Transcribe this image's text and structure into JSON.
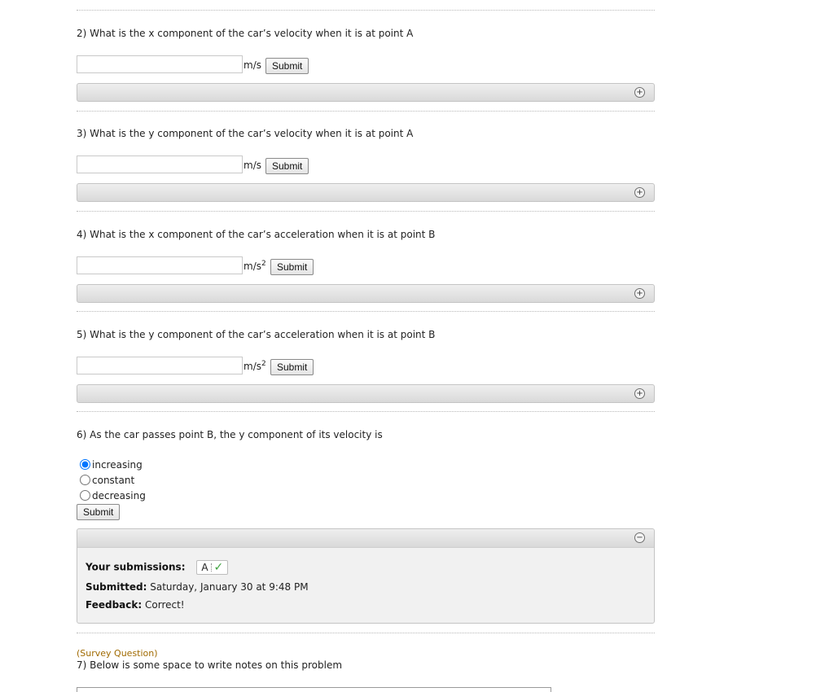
{
  "questions": [
    {
      "label": "2) What is the x component of the car’s velocity when it is at point A",
      "input_value": "",
      "unit": "m/s",
      "unit_exp": "",
      "submit_label": "Submit",
      "toggle": "+"
    },
    {
      "label": "3) What is the y component of the car’s velocity when it is at point A",
      "input_value": "",
      "unit": "m/s",
      "unit_exp": "",
      "submit_label": "Submit",
      "toggle": "+"
    },
    {
      "label": "4) What is the x component of the car’s acceleration when it is at point B",
      "input_value": "",
      "unit": "m/s",
      "unit_exp": "2",
      "submit_label": "Submit",
      "toggle": "+"
    },
    {
      "label": "5) What is the y component of the car’s acceleration when it is at point B",
      "input_value": "",
      "unit": "m/s",
      "unit_exp": "2",
      "submit_label": "Submit",
      "toggle": "+"
    }
  ],
  "q6": {
    "label": "6) As the car passes point B, the y component of its velocity is",
    "options": [
      {
        "label": "increasing",
        "selected": true
      },
      {
        "label": "constant",
        "selected": false
      },
      {
        "label": "decreasing",
        "selected": false
      }
    ],
    "submit_label": "Submit",
    "toggle": "−",
    "panel": {
      "submissions_label": "Your submissions:",
      "submission_value": "A",
      "submission_check": "✓",
      "submitted_label": "Submitted:",
      "submitted_value": "Saturday, January 30 at 9:48 PM",
      "feedback_label": "Feedback:",
      "feedback_value": "Correct!"
    }
  },
  "q7": {
    "survey_tag": "(Survey Question)",
    "label": "7) Below is some space to write notes on this problem"
  },
  "colors": {
    "check": "#3fa33f",
    "survey_tag": "#a06a00"
  },
  "icons": {
    "expand": "expand-plus-icon",
    "collapse": "collapse-minus-icon",
    "check": "check-icon"
  }
}
